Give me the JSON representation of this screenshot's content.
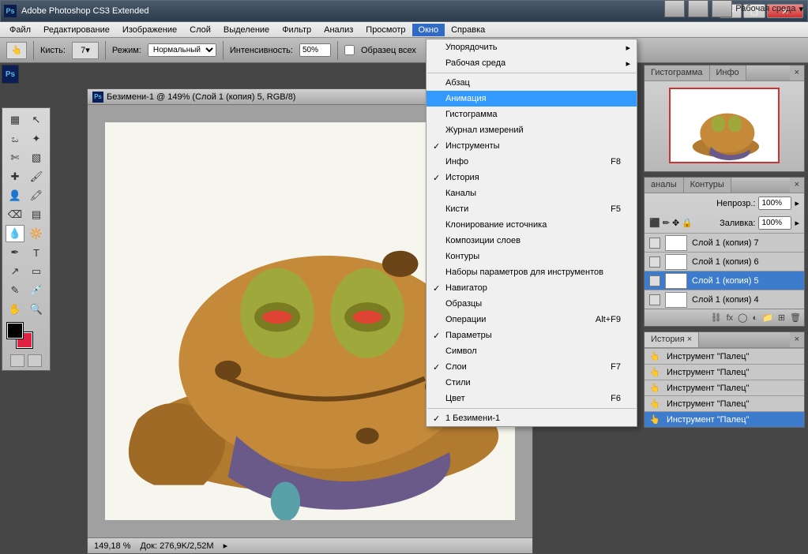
{
  "title": "Adobe Photoshop CS3 Extended",
  "menubar": [
    "Файл",
    "Редактирование",
    "Изображение",
    "Слой",
    "Выделение",
    "Фильтр",
    "Анализ",
    "Просмотр",
    "Окно",
    "Справка"
  ],
  "menubar_open_index": 8,
  "optionsbar": {
    "brush_label": "Кисть:",
    "brush_size": "7",
    "mode_label": "Режим:",
    "mode_value": "Нормальный",
    "intensity_label": "Интенсивность:",
    "intensity_value": "50%",
    "sample_label": "Образец всех",
    "workspace_label": "Рабочая среда"
  },
  "doc": {
    "title": "Безимени-1 @ 149% (Слой 1 (копия) 5, RGB/8)",
    "zoom": "149,18 %",
    "docinfo": "Док: 276,9K/2,52M"
  },
  "dropdown": [
    {
      "t": "item",
      "label": "Упорядочить",
      "arrow": true
    },
    {
      "t": "item",
      "label": "Рабочая среда",
      "arrow": true
    },
    {
      "t": "sep"
    },
    {
      "t": "item",
      "label": "Абзац"
    },
    {
      "t": "item",
      "label": "Анимация",
      "hl": true
    },
    {
      "t": "item",
      "label": "Гистограмма"
    },
    {
      "t": "item",
      "label": "Журнал измерений"
    },
    {
      "t": "item",
      "label": "Инструменты",
      "check": true
    },
    {
      "t": "item",
      "label": "Инфо",
      "sc": "F8"
    },
    {
      "t": "item",
      "label": "История",
      "check": true
    },
    {
      "t": "item",
      "label": "Каналы"
    },
    {
      "t": "item",
      "label": "Кисти",
      "sc": "F5"
    },
    {
      "t": "item",
      "label": "Клонирование источника"
    },
    {
      "t": "item",
      "label": "Композиции слоев"
    },
    {
      "t": "item",
      "label": "Контуры"
    },
    {
      "t": "item",
      "label": "Наборы параметров для инструментов"
    },
    {
      "t": "item",
      "label": "Навигатор",
      "check": true
    },
    {
      "t": "item",
      "label": "Образцы"
    },
    {
      "t": "item",
      "label": "Операции",
      "sc": "Alt+F9"
    },
    {
      "t": "item",
      "label": "Параметры",
      "check": true
    },
    {
      "t": "item",
      "label": "Символ"
    },
    {
      "t": "item",
      "label": "Слои",
      "check": true,
      "sc": "F7"
    },
    {
      "t": "item",
      "label": "Стили"
    },
    {
      "t": "item",
      "label": "Цвет",
      "sc": "F6"
    },
    {
      "t": "sep"
    },
    {
      "t": "item",
      "label": "1 Безимени-1",
      "check": true
    }
  ],
  "nav_tabs": [
    "Гистограмма",
    "Инфо"
  ],
  "layers": {
    "tabs": [
      "аналы",
      "Контуры"
    ],
    "opacity_label": "Непрозр.:",
    "opacity_value": "100%",
    "fill_label": "Заливка:",
    "fill_value": "100%",
    "lock_icons": "🔒 ✚ 🖌 🔒",
    "rows": [
      {
        "name": "Слой 1 (копия) 7"
      },
      {
        "name": "Слой 1 (копия) 6"
      },
      {
        "name": "Слой 1 (копия) 5",
        "sel": true
      },
      {
        "name": "Слой 1 (копия) 4"
      }
    ]
  },
  "history": {
    "tab": "История",
    "rows": [
      {
        "name": "Инструмент \"Палец\""
      },
      {
        "name": "Инструмент \"Палец\""
      },
      {
        "name": "Инструмент \"Палец\""
      },
      {
        "name": "Инструмент \"Палец\""
      },
      {
        "name": "Инструмент \"Палец\"",
        "sel": true
      }
    ]
  },
  "toolnames": [
    "move",
    "marquee",
    "lasso",
    "wand",
    "crop",
    "slice",
    "heal",
    "brush",
    "stamp",
    "history-brush",
    "eraser",
    "gradient",
    "blur",
    "dodge",
    "pen",
    "type",
    "path-sel",
    "shape",
    "notes",
    "eyedropper",
    "hand",
    "zoom"
  ]
}
